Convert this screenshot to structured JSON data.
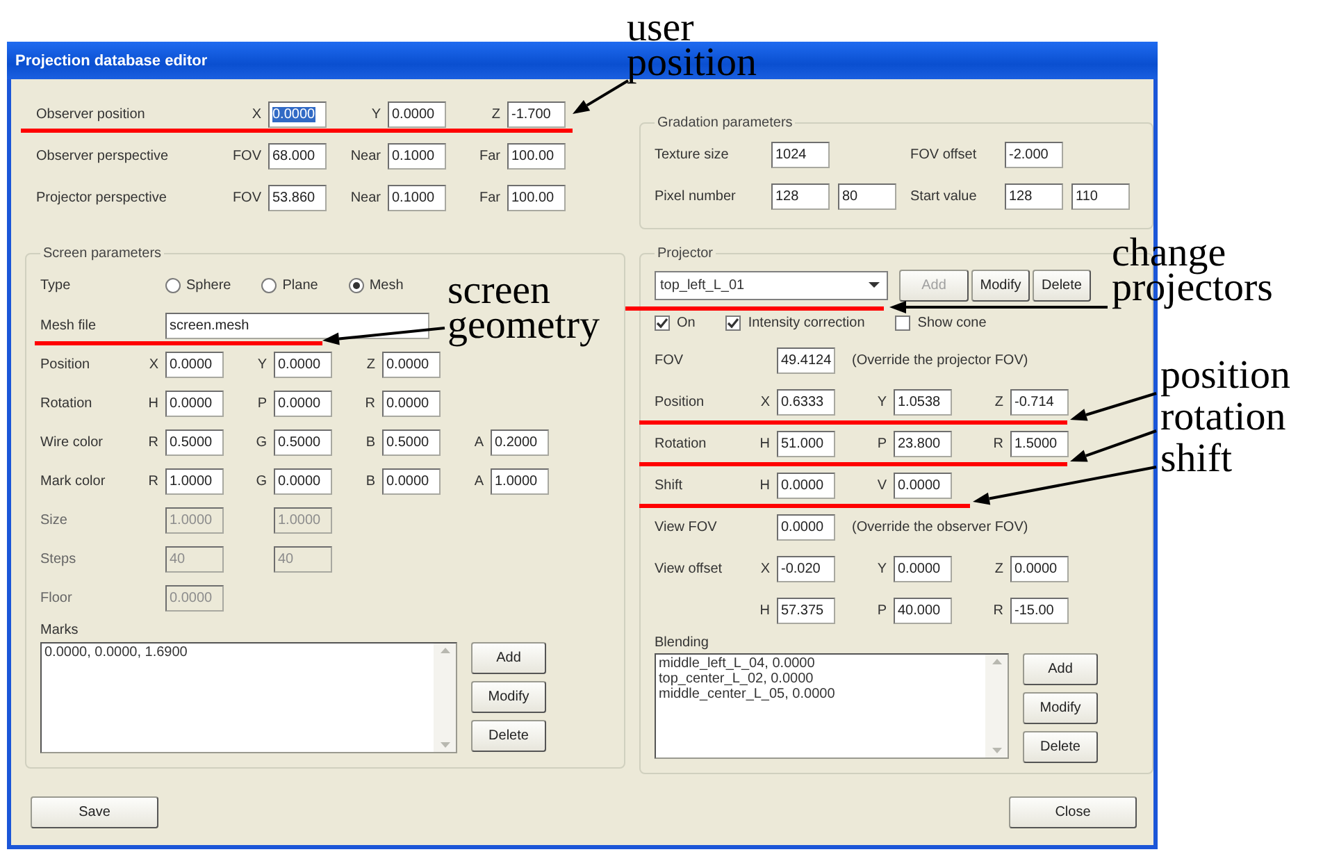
{
  "window": {
    "title": "Projection database editor"
  },
  "observer_rows": [
    {
      "label": "Observer position",
      "fields": [
        {
          "axis": "X",
          "value": "0.0000",
          "highlighted": true
        },
        {
          "axis": "Y",
          "value": "0.0000",
          "highlighted": false
        },
        {
          "axis": "Z",
          "value": "-1.700",
          "highlighted": false
        }
      ]
    },
    {
      "label": "Observer perspective",
      "fields": [
        {
          "axis": "FOV",
          "value": "68.000",
          "highlighted": false
        },
        {
          "axis": "Near",
          "value": "0.1000",
          "highlighted": false
        },
        {
          "axis": "Far",
          "value": "100.00",
          "highlighted": false
        }
      ]
    },
    {
      "label": "Projector perspective",
      "fields": [
        {
          "axis": "FOV",
          "value": "53.860",
          "highlighted": false
        },
        {
          "axis": "Near",
          "value": "0.1000",
          "highlighted": false
        },
        {
          "axis": "Far",
          "value": "100.00",
          "highlighted": false
        }
      ]
    }
  ],
  "screen_parameters": {
    "title": "Screen parameters",
    "type": {
      "label": "Type",
      "options": [
        {
          "label": "Sphere",
          "selected": false
        },
        {
          "label": "Plane",
          "selected": false
        },
        {
          "label": "Mesh",
          "selected": true
        }
      ]
    },
    "mesh_file": {
      "label": "Mesh file",
      "value": "screen.mesh"
    },
    "rows": [
      {
        "label": "Position",
        "disabled": false,
        "fields": [
          {
            "axis": "X",
            "value": "0.0000"
          },
          {
            "axis": "Y",
            "value": "0.0000"
          },
          {
            "axis": "Z",
            "value": "0.0000"
          }
        ]
      },
      {
        "label": "Rotation",
        "disabled": false,
        "fields": [
          {
            "axis": "H",
            "value": "0.0000"
          },
          {
            "axis": "P",
            "value": "0.0000"
          },
          {
            "axis": "R",
            "value": "0.0000"
          }
        ]
      },
      {
        "label": "Wire color",
        "disabled": false,
        "fields": [
          {
            "axis": "R",
            "value": "0.5000"
          },
          {
            "axis": "G",
            "value": "0.5000"
          },
          {
            "axis": "B",
            "value": "0.5000"
          },
          {
            "axis": "A",
            "value": "0.2000"
          }
        ]
      },
      {
        "label": "Mark color",
        "disabled": false,
        "fields": [
          {
            "axis": "R",
            "value": "1.0000"
          },
          {
            "axis": "G",
            "value": "0.0000"
          },
          {
            "axis": "B",
            "value": "0.0000"
          },
          {
            "axis": "A",
            "value": "1.0000"
          }
        ]
      },
      {
        "label": "Size",
        "disabled": true,
        "fields": [
          {
            "value": "1.0000"
          },
          {
            "value": "1.0000"
          }
        ]
      },
      {
        "label": "Steps",
        "disabled": true,
        "fields": [
          {
            "value": "40"
          },
          {
            "value": "40"
          }
        ]
      },
      {
        "label": "Floor",
        "disabled": true,
        "fields": [
          {
            "value": "0.0000"
          }
        ]
      }
    ],
    "marks": {
      "label": "Marks",
      "items": [
        "0.0000, 0.0000, 1.6900"
      ]
    },
    "buttons": [
      "Add",
      "Modify",
      "Delete"
    ]
  },
  "gradation": {
    "title": "Gradation parameters",
    "rows": [
      {
        "groups": [
          {
            "label": "Texture size",
            "values": [
              "1024"
            ]
          },
          {
            "label": "FOV offset",
            "values": [
              "-2.000"
            ]
          }
        ]
      },
      {
        "groups": [
          {
            "label": "Pixel number",
            "values": [
              "128",
              "80"
            ]
          },
          {
            "label": "Start value",
            "values": [
              "128",
              "110"
            ]
          }
        ]
      }
    ]
  },
  "projector": {
    "title": "Projector",
    "selection": "top_left_L_01",
    "buttons": [
      {
        "label": "Add",
        "disabled": true
      },
      {
        "label": "Modify",
        "disabled": false
      },
      {
        "label": "Delete",
        "disabled": false
      }
    ],
    "options": [
      {
        "label": "On",
        "checked": true
      },
      {
        "label": "Intensity correction",
        "checked": true
      },
      {
        "label": "Show cone",
        "checked": false
      }
    ],
    "rows": [
      {
        "label": "FOV",
        "fields": [
          {
            "value": "49.4124"
          }
        ],
        "note": "(Override the projector FOV)"
      },
      {
        "label": "Position",
        "fields": [
          {
            "axis": "X",
            "value": "0.6333"
          },
          {
            "axis": "Y",
            "value": "1.0538"
          },
          {
            "axis": "Z",
            "value": "-0.714"
          }
        ]
      },
      {
        "label": "Rotation",
        "fields": [
          {
            "axis": "H",
            "value": "51.000"
          },
          {
            "axis": "P",
            "value": "23.800"
          },
          {
            "axis": "R",
            "value": "1.5000"
          }
        ]
      },
      {
        "label": "Shift",
        "fields": [
          {
            "axis": "H",
            "value": "0.0000"
          },
          {
            "axis": "V",
            "value": "0.0000"
          }
        ]
      },
      {
        "label": "View FOV",
        "fields": [
          {
            "value": "0.0000"
          }
        ],
        "note": "(Override the observer FOV)"
      },
      {
        "label": "View offset",
        "fields": [
          {
            "axis": "X",
            "value": "-0.020"
          },
          {
            "axis": "Y",
            "value": "0.0000"
          },
          {
            "axis": "Z",
            "value": "0.0000"
          }
        ]
      },
      {
        "fields": [
          {
            "axis": "H",
            "value": "57.375"
          },
          {
            "axis": "P",
            "value": "40.000"
          },
          {
            "axis": "R",
            "value": "-15.00"
          }
        ]
      }
    ],
    "blending": {
      "label": "Blending",
      "items": [
        "middle_left_L_04, 0.0000",
        "top_center_L_02, 0.0000",
        "middle_center_L_05, 0.0000"
      ]
    },
    "list_buttons": [
      "Add",
      "Modify",
      "Delete"
    ]
  },
  "footer": {
    "buttons": [
      "Save",
      "Close"
    ]
  },
  "annotations": [
    {
      "lines": [
        "user",
        "position"
      ]
    },
    {
      "lines": [
        "change",
        "projectors"
      ]
    },
    {
      "lines": [
        "screen",
        "geometry"
      ]
    },
    {
      "lines": [
        "position"
      ]
    },
    {
      "lines": [
        "rotation"
      ]
    },
    {
      "lines": [
        "shift"
      ]
    }
  ]
}
